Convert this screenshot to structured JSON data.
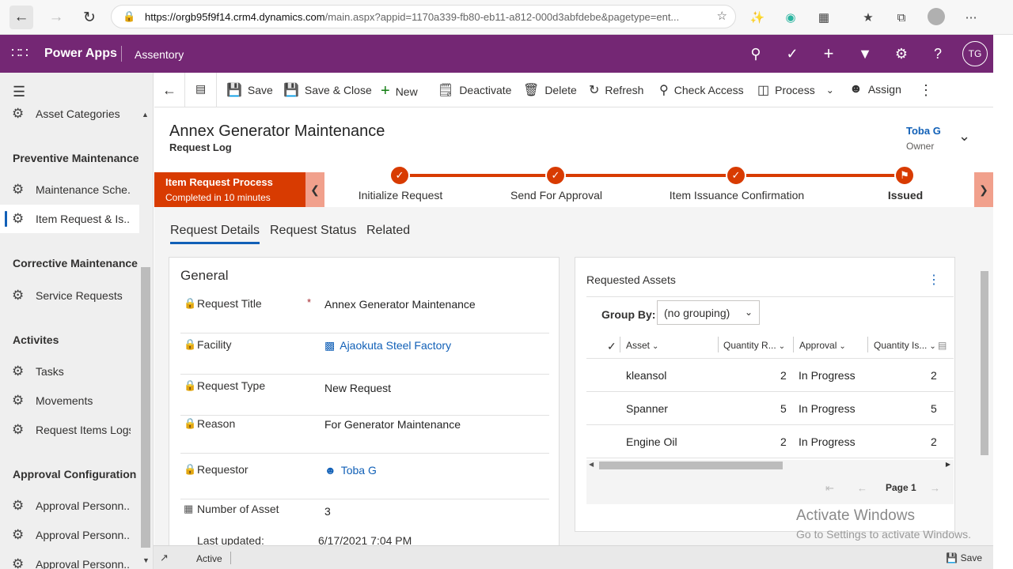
{
  "browser": {
    "url_host": "https://orgb95f9f14.crm4.dynamics.com",
    "url_path": "/main.aspx?appid=1170a339-fb80-eb11-a812-000d3abfdebe&pagetype=ent..."
  },
  "appbar": {
    "brand": "Power Apps",
    "app_name": "Assentory",
    "user_initials": "TG"
  },
  "sidebar": {
    "top_item": "Asset Categories",
    "groups": [
      {
        "title": "Preventive Maintenance",
        "items": [
          "Maintenance Sche...",
          "Item Request & Is..."
        ]
      },
      {
        "title": "Corrective Maintenance",
        "items": [
          "Service Requests"
        ]
      },
      {
        "title": "Activites",
        "items": [
          "Tasks",
          "Movements",
          "Request Items Logs"
        ]
      },
      {
        "title": "Approval Configuration",
        "items": [
          "Approval Personn...",
          "Approval Personn...",
          "Approval Personn..."
        ]
      }
    ]
  },
  "commands": {
    "save": "Save",
    "save_close": "Save & Close",
    "new": "New",
    "deactivate": "Deactivate",
    "delete": "Delete",
    "refresh": "Refresh",
    "check_access": "Check Access",
    "process": "Process",
    "assign": "Assign"
  },
  "record": {
    "title": "Annex Generator Maintenance",
    "entity": "Request Log",
    "owner_name": "Toba G",
    "owner_label": "Owner"
  },
  "bpf": {
    "process_name": "Item Request Process",
    "process_status": "Completed in 10 minutes",
    "stages": [
      "Initialize Request",
      "Send For Approval",
      "Item Issuance Confirmation",
      "Issued"
    ]
  },
  "tabs": [
    "Request Details",
    "Request Status",
    "Related"
  ],
  "general": {
    "heading": "General",
    "fields": [
      {
        "label": "Request Title",
        "value": "Annex Generator Maintenance",
        "required": "*"
      },
      {
        "label": "Facility",
        "value": "Ajaokuta Steel Factory"
      },
      {
        "label": "Request Type",
        "value": "New Request"
      },
      {
        "label": "Reason",
        "value": "For Generator Maintenance"
      },
      {
        "label": "Requestor",
        "value": "Toba G"
      },
      {
        "label": "Number of Asset",
        "value": "3"
      }
    ],
    "last_updated_label": "Last updated:",
    "last_updated_value": "6/17/2021 7:04 PM"
  },
  "assets": {
    "heading": "Requested Assets",
    "group_by_label": "Group By:",
    "group_by_value": "(no grouping)",
    "columns": [
      "Asset",
      "Quantity R...",
      "Approval",
      "Quantity Is..."
    ],
    "rows": [
      {
        "asset": "kleansol",
        "qty_req": "2",
        "approval": "In Progress",
        "qty_iss": "2"
      },
      {
        "asset": "Spanner",
        "qty_req": "5",
        "approval": "In Progress",
        "qty_iss": "5"
      },
      {
        "asset": "Engine Oil",
        "qty_req": "2",
        "approval": "In Progress",
        "qty_iss": "2"
      }
    ],
    "page_label": "Page 1"
  },
  "watermark": {
    "line1": "Activate Windows",
    "line2": "Go to Settings to activate Windows."
  },
  "status": {
    "state": "Active",
    "save": "Save"
  },
  "colors": {
    "appbar": "#742774",
    "bpf_accent": "#d83b01",
    "link": "#1160b7"
  }
}
